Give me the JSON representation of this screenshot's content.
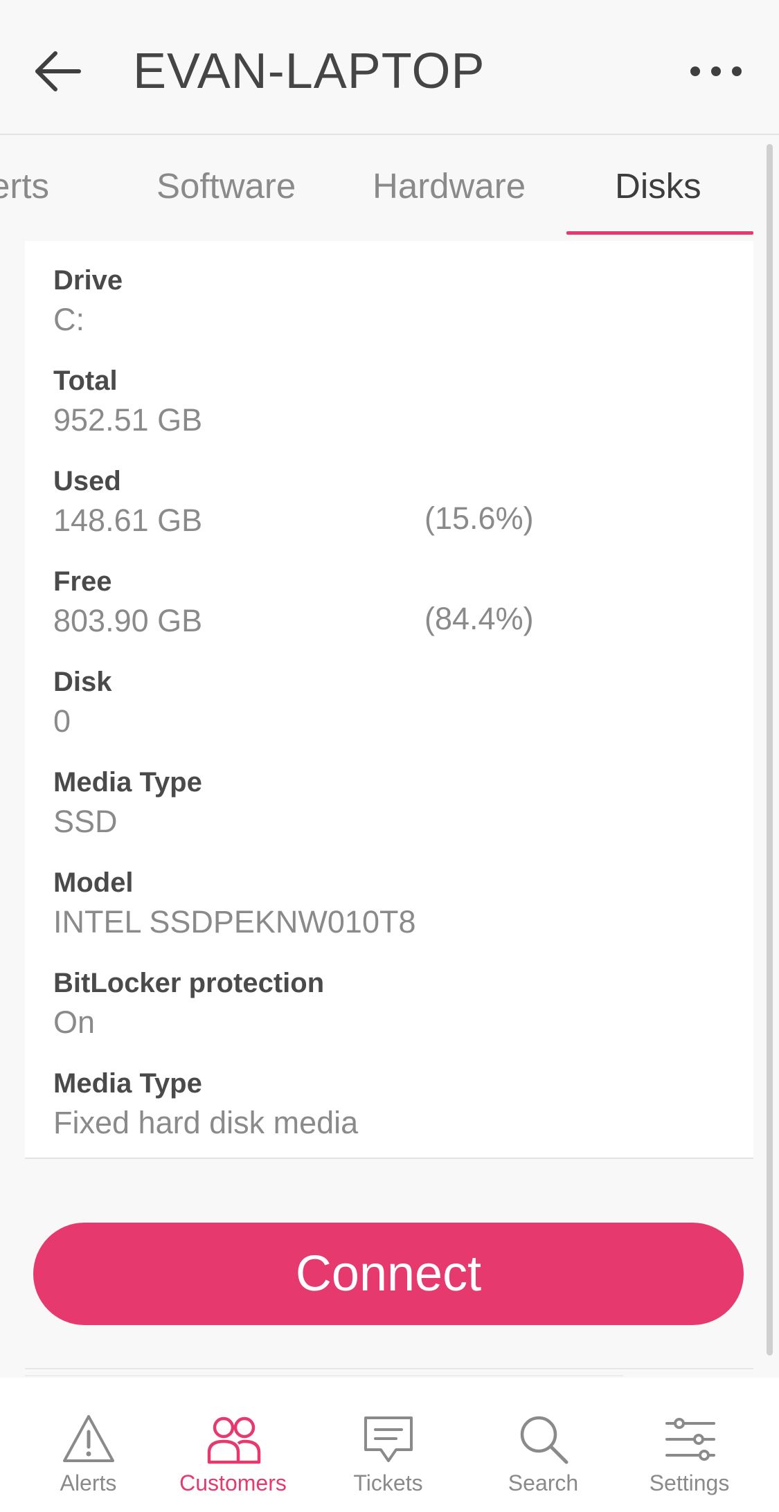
{
  "header": {
    "title": "EVAN-LAPTOP",
    "back_icon": "arrow-left-icon",
    "more_icon": "more-horizontal-icon"
  },
  "tabs": [
    {
      "label": "Alerts",
      "visible_text": "erts"
    },
    {
      "label": "Software"
    },
    {
      "label": "Hardware"
    },
    {
      "label": "Disks",
      "active": true
    }
  ],
  "disk": {
    "drive": {
      "label": "Drive",
      "value": "C:"
    },
    "total": {
      "label": "Total",
      "value": "952.51 GB"
    },
    "used": {
      "label": "Used",
      "value": "148.61 GB",
      "percent": "(15.6%)"
    },
    "free": {
      "label": "Free",
      "value": "803.90 GB",
      "percent": "(84.4%)"
    },
    "disk": {
      "label": "Disk",
      "value": "0"
    },
    "media_type": {
      "label": "Media Type",
      "value": "SSD"
    },
    "model": {
      "label": "Model",
      "value": "INTEL SSDPEKNW010T8"
    },
    "bitlocker": {
      "label": "BitLocker protection",
      "value": "On"
    },
    "media_type_2": {
      "label": "Media Type",
      "value": "Fixed hard disk media"
    }
  },
  "connect": {
    "label": "Connect"
  },
  "nav": [
    {
      "label": "Alerts",
      "icon": "warning-triangle-icon"
    },
    {
      "label": "Customers",
      "icon": "customers-icon",
      "active": true
    },
    {
      "label": "Tickets",
      "icon": "message-icon"
    },
    {
      "label": "Search",
      "icon": "search-icon"
    },
    {
      "label": "Settings",
      "icon": "sliders-icon"
    }
  ],
  "colors": {
    "accent": "#e63a6f",
    "text_dark": "#454545",
    "text_muted": "#8a8a8a",
    "background": "#f8f8f8"
  }
}
